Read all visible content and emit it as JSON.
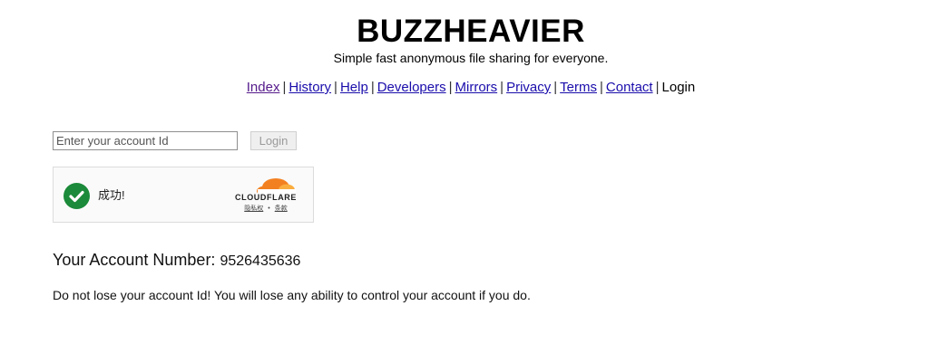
{
  "header": {
    "title": "BUZZHEAVIER",
    "tagline": "Simple fast anonymous file sharing for everyone."
  },
  "nav": {
    "links": [
      "Index",
      "History",
      "Help",
      "Developers",
      "Mirrors",
      "Privacy",
      "Terms",
      "Contact"
    ],
    "current": "Login",
    "separator": "|"
  },
  "login": {
    "input_placeholder": "Enter your account Id",
    "input_value": "",
    "button_label": "Login"
  },
  "captcha": {
    "status": "成功!",
    "brand": "CLOUDFLARE",
    "links": [
      "隐私权",
      "条款"
    ],
    "colors": {
      "success": "#1b8a3a",
      "brand_orange": "#f38020",
      "brand_light": "#faad3f"
    }
  },
  "account": {
    "label": "Your Account Number:",
    "number": "9526435636",
    "warning": "Do not lose your account Id! You will lose any ability to control your account if you do."
  },
  "colors": {
    "link": "#1a0dab",
    "visited_link": "#551a8b"
  }
}
